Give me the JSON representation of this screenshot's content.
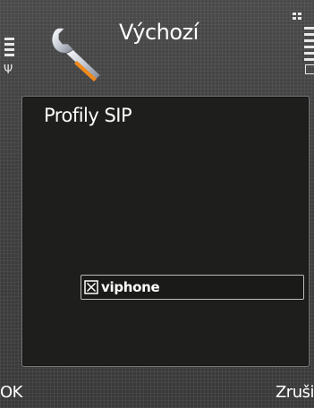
{
  "header": {
    "title": "Výchozí",
    "app_icon": "wrench-settings-icon",
    "signal_icon": "signal-strength-icon",
    "battery_icon": "battery-level-icon",
    "menu_icon": "menu-grid-icon"
  },
  "panel": {
    "title": "Profily SIP",
    "items": [
      {
        "label": "viphone",
        "checked": true,
        "icon": "checkbox-checked-icon"
      }
    ]
  },
  "softkeys": {
    "left": "OK",
    "right": "Zruši"
  },
  "colors": {
    "background": "#3f3f3f",
    "panel_background": "#1e1f1c",
    "text": "#ffffff",
    "wrench_accent": "#f08a1c"
  }
}
